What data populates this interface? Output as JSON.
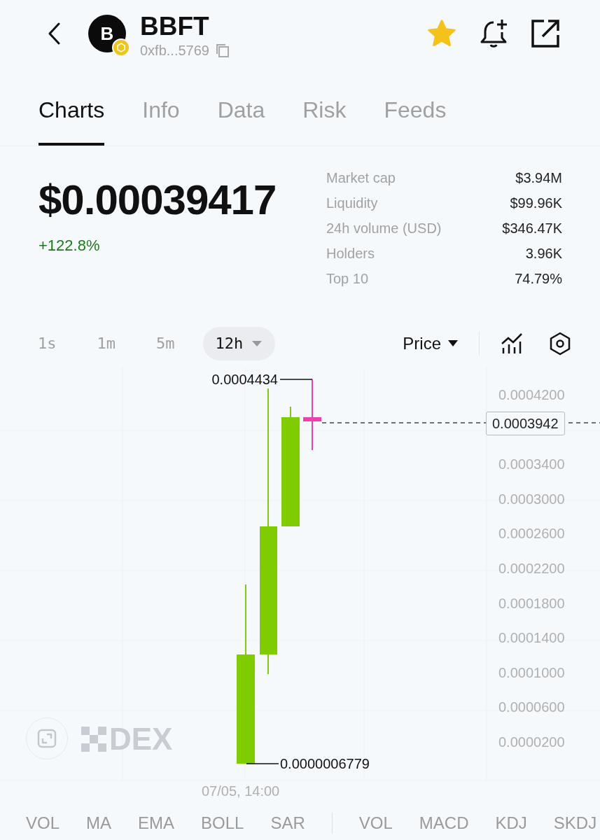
{
  "header": {
    "symbol": "BBFT",
    "avatar_letter": "B",
    "address": "0xfb...5769",
    "favorite": true
  },
  "tabs": [
    {
      "label": "Charts",
      "selected": true
    },
    {
      "label": "Info",
      "selected": false
    },
    {
      "label": "Data",
      "selected": false
    },
    {
      "label": "Risk",
      "selected": false
    },
    {
      "label": "Feeds",
      "selected": false
    }
  ],
  "price": {
    "value": "$0.00039417",
    "change": "+122.8%"
  },
  "stats": [
    {
      "label": "Market cap",
      "value": "$3.94M"
    },
    {
      "label": "Liquidity",
      "value": "$99.96K"
    },
    {
      "label": "24h volume (USD)",
      "value": "$346.47K"
    },
    {
      "label": "Holders",
      "value": "3.96K"
    },
    {
      "label": "Top 10",
      "value": "74.79%"
    }
  ],
  "intervals": [
    {
      "label": "1s",
      "selected": false
    },
    {
      "label": "1m",
      "selected": false
    },
    {
      "label": "5m",
      "selected": false
    },
    {
      "label": "12h",
      "selected": true
    }
  ],
  "price_mode": "Price",
  "chart": {
    "high_label": "0.0004434",
    "low_label": "0.0000006779",
    "current_price": "0.0003942",
    "y_labels": [
      "0.0004200",
      "0.0003400",
      "0.0003000",
      "0.0002600",
      "0.0002200",
      "0.0001800",
      "0.0001400",
      "0.0001000",
      "0.0000600",
      "0.0000200"
    ],
    "time_label": "07/05, 14:00",
    "watermark": "DEX"
  },
  "indicators": {
    "main": [
      "VOL",
      "MA",
      "EMA",
      "BOLL",
      "SAR"
    ],
    "sub": [
      "VOL",
      "MACD",
      "KDJ",
      "SKDJ"
    ]
  }
}
